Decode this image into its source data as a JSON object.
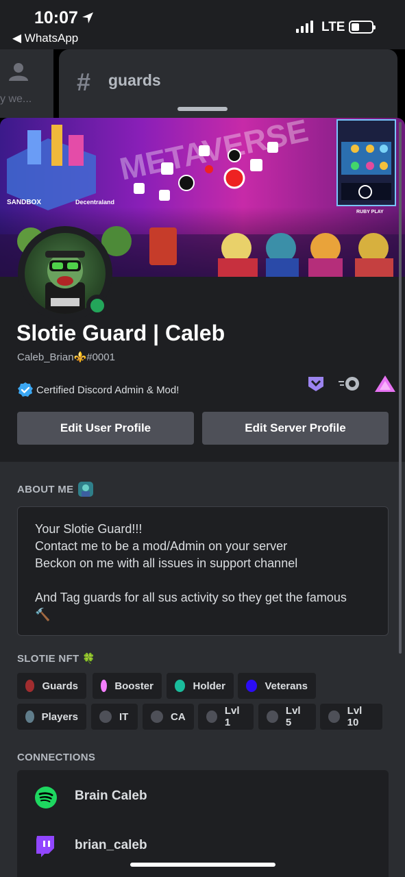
{
  "status_bar": {
    "time": "10:07",
    "back_app": "◀ WhatsApp",
    "network": "LTE"
  },
  "background": {
    "partial_text": "y we...",
    "channel_hash": "#",
    "channel_name": "guards"
  },
  "banner": {
    "logo_left": "SANDBOX",
    "logo_middle": "Decentraland",
    "logo_right": "RUBY PLAY"
  },
  "profile": {
    "display_name": "Slotie Guard | Caleb",
    "username": "Caleb_Brian⚜️#0001",
    "custom_status": "Certified Discord Admin & Mod!",
    "status_color": "#23a55a",
    "badges": [
      "hypesquad-icon",
      "nitro-boost-icon",
      "triangle-badge-icon"
    ]
  },
  "buttons": {
    "edit_user": "Edit User Profile",
    "edit_server": "Edit Server Profile"
  },
  "about": {
    "title": "ABOUT ME",
    "lines": [
      "Your Slotie Guard!!!",
      "Contact me to be a mod/Admin on your server",
      "Beckon on me with all issues in support channel",
      "",
      "And Tag guards for all sus activity so they get the famous",
      "🔨"
    ]
  },
  "roles_section": {
    "title": "SLOTIE NFT 🍀",
    "roles": [
      {
        "label": "Guards",
        "color": "#a12d2f"
      },
      {
        "label": "Booster",
        "color": "#f47fff"
      },
      {
        "label": "Holder",
        "color": "#1abc9c"
      },
      {
        "label": "Veterans",
        "color": "#2b0cf5"
      },
      {
        "label": "Players",
        "color": "#607d8b"
      },
      {
        "label": "IT",
        "color": "#4e5058"
      },
      {
        "label": "CA",
        "color": "#4e5058"
      },
      {
        "label": "Lvl 1",
        "color": "#4e5058"
      },
      {
        "label": "Lvl 5",
        "color": "#4e5058"
      },
      {
        "label": "Lvl 10",
        "color": "#4e5058"
      }
    ]
  },
  "connections": {
    "title": "CONNECTIONS",
    "items": [
      {
        "service": "spotify-icon",
        "name": "Brain Caleb"
      },
      {
        "service": "twitch-icon",
        "name": "brian_caleb"
      }
    ]
  }
}
